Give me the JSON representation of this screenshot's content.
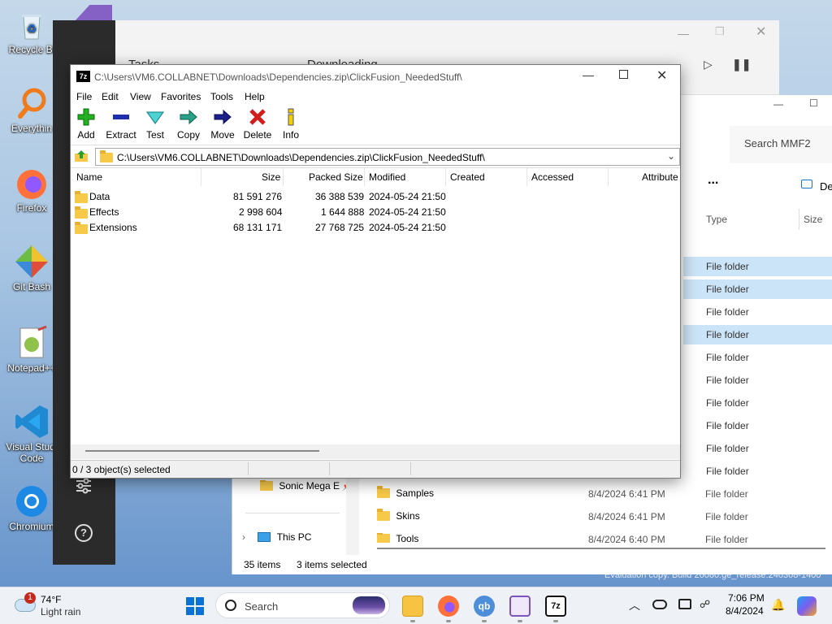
{
  "desktop": {
    "icons": [
      "Recycle Bin",
      "Everything",
      "Firefox",
      "Git Bash",
      "Notepad++",
      "Visual Studio Code",
      "Chromium"
    ],
    "icon_line1": [
      "Recycle Bi",
      "Everythin",
      "Firefox",
      "Git Bash",
      "Notepad++",
      "Visual Studi",
      "Chromium"
    ],
    "icon_line2": [
      "",
      "",
      "",
      "",
      "",
      "Code",
      ""
    ]
  },
  "back_app": {
    "tab1": "Tasks",
    "tab2": "Downloading"
  },
  "explorer": {
    "search_placeholder": "Search MMF2",
    "more": "...",
    "details_btn": "De",
    "col_type": "Type",
    "col_size": "Size",
    "types": [
      "File folder",
      "File folder",
      "File folder",
      "File folder",
      "File folder",
      "File folder",
      "File folder",
      "File folder",
      "File folder",
      "File folder",
      "File folder",
      "File folder",
      "File folder"
    ],
    "nav_sonic": "Sonic Mega E",
    "nav_thispc": "This PC",
    "rows": [
      {
        "name": "Samples",
        "date": "8/4/2024 6:41 PM",
        "type": "File folder"
      },
      {
        "name": "Skins",
        "date": "8/4/2024 6:41 PM",
        "type": "File folder"
      },
      {
        "name": "Tools",
        "date": "8/4/2024 6:40 PM",
        "type": "File folder"
      }
    ],
    "status_items": "35 items",
    "status_selected": "3 items selected",
    "watermark": "Evaluation copy. Build 26080.ge_release.240308-1400"
  },
  "zip": {
    "title": "C:\\Users\\VM6.COLLABNET\\Downloads\\Dependencies.zip\\ClickFusion_NeededStuff\\",
    "app_icon": "7z",
    "menu": [
      "File",
      "Edit",
      "View",
      "Favorites",
      "Tools",
      "Help"
    ],
    "toolbar": [
      "Add",
      "Extract",
      "Test",
      "Copy",
      "Move",
      "Delete",
      "Info"
    ],
    "address": "C:\\Users\\VM6.COLLABNET\\Downloads\\Dependencies.zip\\ClickFusion_NeededStuff\\",
    "columns": [
      "Name",
      "Size",
      "Packed Size",
      "Modified",
      "Created",
      "Accessed",
      "Attribute"
    ],
    "files": [
      {
        "name": "Data",
        "size": "81 591 276",
        "packed": "36 388 539",
        "modified": "2024-05-24 21:50"
      },
      {
        "name": "Effects",
        "size": "2 998 604",
        "packed": "1 644 888",
        "modified": "2024-05-24 21:50"
      },
      {
        "name": "Extensions",
        "size": "68 131 171",
        "packed": "27 768 725",
        "modified": "2024-05-24 21:50"
      }
    ],
    "status": "0 / 3 object(s) selected"
  },
  "taskbar": {
    "weather_temp": "74°F",
    "weather_desc": "Light rain",
    "weather_badge": "1",
    "search": "Search",
    "time": "7:06 PM",
    "date": "8/4/2024",
    "sevenzip_label": "7z",
    "qb_label": "qb"
  },
  "colors": {
    "accent": "#0067c0",
    "selection": "#cce4f7",
    "folder": "#f7c948"
  }
}
